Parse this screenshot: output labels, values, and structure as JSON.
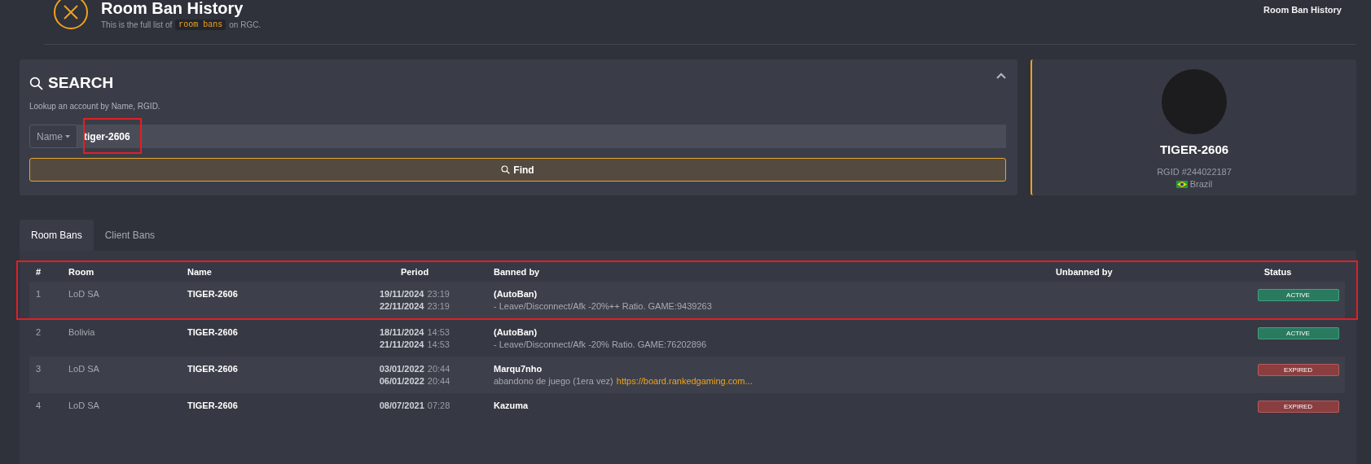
{
  "header": {
    "title": "Room Ban History",
    "subtitle_start": "This is the full list of",
    "subtitle_code": "room bans",
    "subtitle_end": "on RGC.",
    "breadcrumb": "Room Ban History"
  },
  "search": {
    "title": "SEARCH",
    "hint": "Lookup an account by Name, RGID.",
    "field_type": "Name",
    "value": "tiger-2606",
    "button": "Find"
  },
  "profile": {
    "name": "TIGER-2606",
    "rgid": "RGID #244022187",
    "country": "Brazil"
  },
  "tabs": [
    {
      "label": "Room Bans",
      "selected": true
    },
    {
      "label": "Client Bans",
      "selected": false
    }
  ],
  "table": {
    "columns": [
      "#",
      "Room",
      "Name",
      "Period",
      "Banned by",
      "Unbanned by",
      "Status"
    ],
    "rows": [
      {
        "number": "1",
        "room": "LoD SA",
        "name": "TIGER-2606",
        "start_date": "19/11/2024",
        "start_time": "23:19",
        "end_date": "22/11/2024",
        "end_time": "23:19",
        "banned_by": "(AutoBan)",
        "reason": "- Leave/Disconnect/Afk -20%++ Ratio. GAME:9439263",
        "status": "ACTIVE",
        "active": true
      },
      {
        "number": "2",
        "room": "Bolivia",
        "name": "TIGER-2606",
        "start_date": "18/11/2024",
        "start_time": "14:53",
        "end_date": "21/11/2024",
        "end_time": "14:53",
        "banned_by": "(AutoBan)",
        "reason": "- Leave/Disconnect/Afk -20% Ratio. GAME:76202896",
        "status": "ACTIVE",
        "active": true
      },
      {
        "number": "3",
        "room": "LoD SA",
        "name": "TIGER-2606",
        "start_date": "03/01/2022",
        "start_time": "20:44",
        "end_date": "06/01/2022",
        "end_time": "20:44",
        "banned_by": "Marqu7nho",
        "reason": "abandono de juego (1era vez)",
        "link": "https://board.rankedgaming.com...",
        "status": "EXPIRED",
        "active": false
      },
      {
        "number": "4",
        "room": "LoD SA",
        "name": "TIGER-2606",
        "start_date": "08/07/2021",
        "start_time": "07:28",
        "banned_by": "Kazuma",
        "status": "EXPIRED",
        "active": false
      }
    ]
  }
}
